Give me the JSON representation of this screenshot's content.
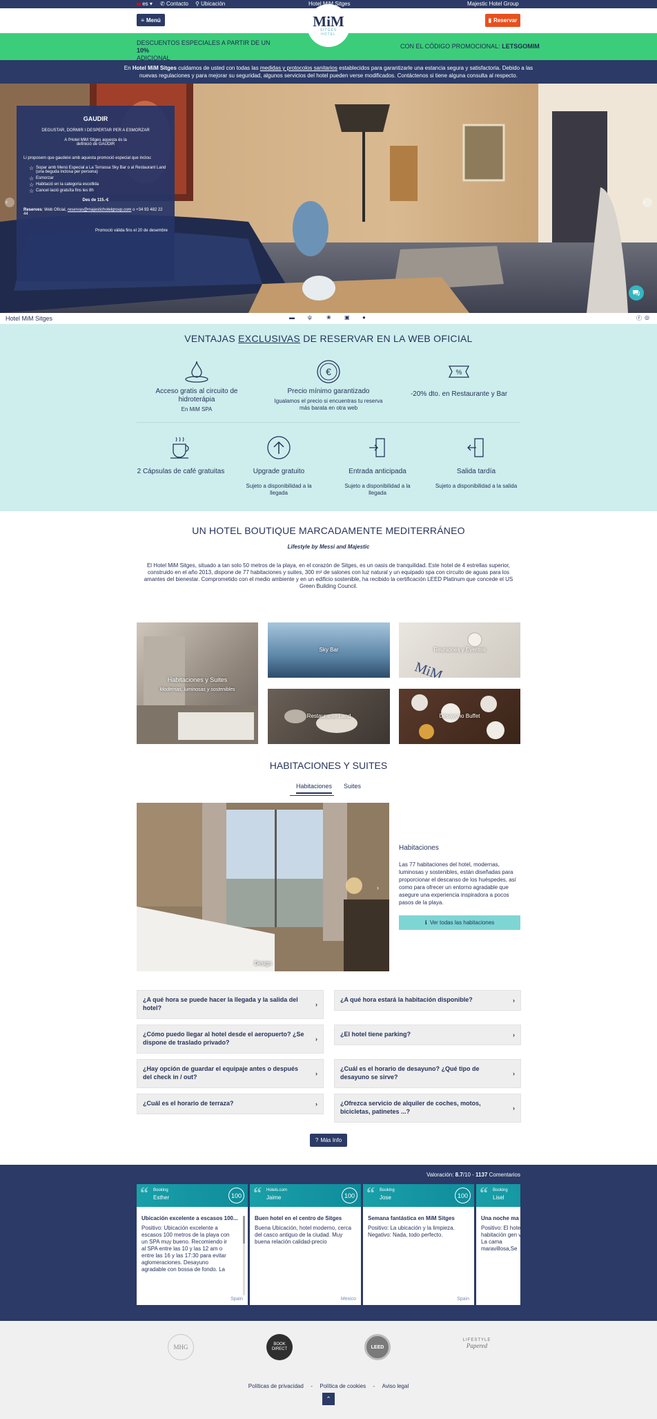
{
  "topbar": {
    "lang": "es",
    "contact": "Contacto",
    "location": "Ubicación",
    "hotel": "Hotel MiM Sitges",
    "group": "Majestic Hotel Group"
  },
  "header": {
    "menu_label": "Menú",
    "reservar_label": "Reservar",
    "logo_text": "MiM",
    "logo_sub_1": "SITGES",
    "logo_sub_2": "HOTEL"
  },
  "promo": {
    "left_text": "DESCUENTOS ESPECIALES A PARTIR DE UN",
    "left_bold": "10%",
    "left_text_2": "ADICIONAL",
    "right_text": "CON EL CÓDIGO PROMOCIONAL:",
    "code": "LETSGOMIM"
  },
  "notice": {
    "part1": "En",
    "hotel": "Hotel MiM Sitges",
    "part2": "cuidamos de usted con todas las",
    "link": "medidas y protocolos sanitarios",
    "part3": "establecidos para garantizarle una estancia segura y satisfactoria. Debido a las",
    "line2": "nuevas regulaciones y para mejorar su seguridad, algunos servicios del hotel pueden verse modificados. Contáctenos si tiene alguna consulta al respecto."
  },
  "hero_box": {
    "title": "GAUDIR",
    "subtitle": "DEGUSTAR, DORMIR I DESPERTAR PER A ESMORZAR",
    "intro": "A l'Hotel MiM Sitges aquesta és la definició de GAUDIR",
    "line": "Li proposem que gaudeixi amb aquesta promoció especial que inclou:",
    "items": [
      "Sopar amb Menú Especial a La Terrassa Sky Bar o al Restaurant Land (una beguda inclosa per persona)",
      "Esmorzar",
      "Habitació en la categoria escollida",
      "Cancel·lació gratuïta fins les 8h"
    ],
    "price": "Des de 115.-€",
    "reserves_label": "Reserves",
    "reserves_text": ": Web Oficial,",
    "email": "reservas@majestichotelgroup.com",
    "phone": "o +34 93 482 22 44",
    "valid": "Promoció vàlida fins el 20 de desembre"
  },
  "strip": {
    "name": "Hotel MiM Sitges"
  },
  "ventajas": {
    "title_1": "VENTAJAS",
    "title_2": "EXCLUSIVAS",
    "title_3": "DE RESERVAR EN LA WEB OFICIAL",
    "items": [
      {
        "title": "Acceso gratis al circuito de hidroterápia",
        "sub": "En MiM SPA"
      },
      {
        "title": "Precio mínimo garantizado",
        "sub": "Igualamos el precio si encuentras tu reserva más barata en otra web"
      },
      {
        "title": "-20% dto. en Restaurante y Bar",
        "sub": ""
      },
      {
        "title": "2 Cápsulas de café gratuitas",
        "sub": ""
      },
      {
        "title": "Upgrade gratuito",
        "sub": "Sujeto a disponibilidad a la llegada"
      },
      {
        "title": "Entrada anticipada",
        "sub": "Sujeto a disponibilidad a la llegada"
      },
      {
        "title": "Salida tardía",
        "sub": "Sujeto a disponibilidad a la salida"
      }
    ]
  },
  "boutique": {
    "title": "UN HOTEL BOUTIQUE MARCADAMENTE MEDITERRÁNEO",
    "subtitle": "Lifestyle by Messi and Majestic",
    "text": "El Hotel MiM Sitges, situado a tan solo 50 metros de la playa, en el corazón de Sitges, es un oasis de tranquilidad. Este hotel de 4 estrellas superior, construido en el año 2013, dispone de 77 habitaciones y suites, 300 m² de salones con luz natural y un equipado spa con circuito de aguas para los amantes del bienestar. Comprometido con el medio ambiente y en un edificio sostenible, ha recibido la certificación LEED Platinum que concede el US Green Building Council."
  },
  "gallery": {
    "habitaciones": "Habitaciones y Suites",
    "habitaciones_sub": "Modernas, luminosas y sostenibles",
    "skybar": "Sky Bar",
    "reuniones": "Reuniones y Eventos",
    "restaurante": "Restaurante Land",
    "desayuno": "Desayuno Buffet"
  },
  "rooms": {
    "title": "HABITACIONES Y SUITES",
    "tab1": "Habitaciones",
    "tab2": "Suites",
    "caption": "Design",
    "heading": "Habitaciones",
    "text": "Las 77 habitaciones del hotel, modernas, luminosas y sostenibles, están diseñadas para proporcionar el descanso de los huéspedes, así como para ofrecer un entorno agradable que asegure una experiencia inspiradora a pocos pasos de la playa.",
    "button": "Ver todas las habitaciones"
  },
  "faq": [
    "¿A qué hora se puede hacer la llegada y la salida del hotel?",
    "¿A qué hora estará la habitación disponible?",
    "¿Cómo puedo llegar al hotel desde el aeropuerto? ¿Se dispone de traslado privado?",
    "¿El hotel tiene parking?",
    "¿Hay opción de guardar el equipaje antes o después del check in / out?",
    "¿Cuál es el horario de desayuno? ¿Qué tipo de desayuno se sirve?",
    "¿Cuál es el horario de terraza?",
    "¿Ofrezca servicio de alquiler de coches, motos, bicicletas, patinetes ...?"
  ],
  "mas_info": "Más Info",
  "reviews": {
    "rating_label": "Valoración:",
    "score": "8.7",
    "score_max": "/10 -",
    "count": "1137",
    "count_label": "Comentarios",
    "cards": [
      {
        "source": "Booking",
        "name": "Esther",
        "score": "100",
        "title": "Ubicación excelente a escasos 100...",
        "body": "Positivo: Ubicación excelente a escasos 100 metros de la playa con un SPA muy bueno. Recomiendo ir al SPA entre las 10 y las 12 am o entre las 16 y las 17:30 para evitar aglomeraciones. Desayuno agradable con bossa de fondo. La",
        "country": "Spain"
      },
      {
        "source": "Hotels.com",
        "name": "Jaime",
        "score": "100",
        "title": "Buen hotel en el centro de Sitges",
        "body": "Buena Ubicación, hotel moderno, cerca del casco antiguo de la ciudad. Muy buena relación calidad-precio",
        "country": "Mexico"
      },
      {
        "source": "Booking",
        "name": "Jose",
        "score": "100",
        "title": "Semana fantástica en MiM Sitges",
        "body": "Positivo: La ubicación y la limpieza. Negativo: Nada, todo perfecto.",
        "country": "Spain"
      },
      {
        "source": "Booking",
        "name": "Lisel",
        "score": "",
        "title": "Una noche ma",
        "body": "Positivo: El hotel habitación gen vistas. La cama maravillosa,Se",
        "country": ""
      }
    ]
  },
  "footer": {
    "logo1": "MHG",
    "logo2_a": "BOOK",
    "logo2_b": "DIRECT",
    "logo3": "LEED",
    "logo4_a": "LIFESTYLE",
    "logo4_b": "Papered",
    "links": [
      "Políticas de privacidad",
      "Política de cookies",
      "Aviso legal"
    ],
    "sep": "-"
  },
  "colors": {
    "navy": "#2b3a66",
    "green": "#3ccd7a",
    "orange": "#e8501f",
    "mint": "#cdeeed",
    "teal": "#7ed6d4"
  }
}
